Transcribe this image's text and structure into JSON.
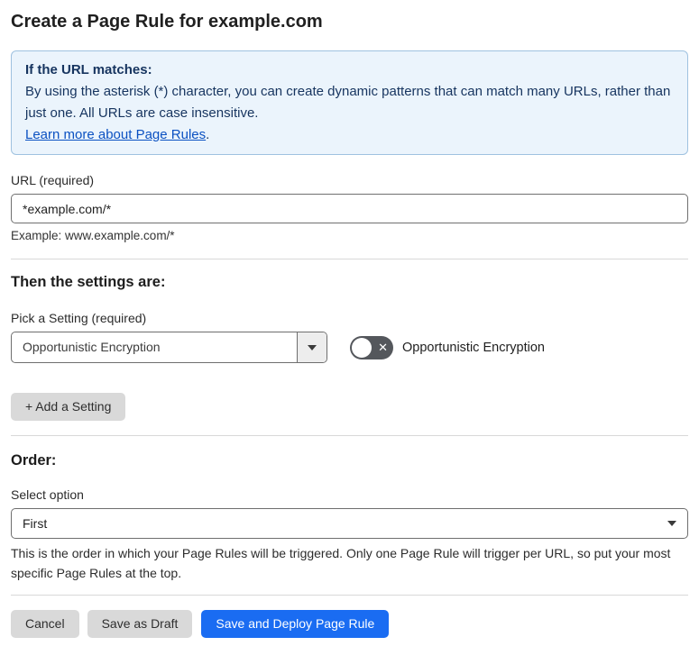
{
  "page": {
    "title": "Create a Page Rule for example.com"
  },
  "info_box": {
    "heading": "If the URL matches:",
    "body": "By using the asterisk (*) character, you can create dynamic patterns that can match many URLs, rather than just one. All URLs are case insensitive.",
    "link_label": "Learn more about Page Rules",
    "link_suffix": "."
  },
  "url_section": {
    "label": "URL (required)",
    "value": "*example.com/*",
    "example": "Example: www.example.com/*"
  },
  "settings_section": {
    "heading": "Then the settings are:",
    "label": "Pick a Setting (required)",
    "selected_setting": "Opportunistic Encryption",
    "toggle": {
      "state": "off",
      "label": "Opportunistic Encryption"
    },
    "add_button_label": "+ Add a Setting"
  },
  "order_section": {
    "heading": "Order:",
    "label": "Select option",
    "selected_option": "First",
    "help": "This is the order in which your Page Rules will be triggered. Only one Page Rule will trigger per URL, so put your most specific Page Rules at the top."
  },
  "footer": {
    "cancel_label": "Cancel",
    "save_draft_label": "Save as Draft",
    "deploy_label": "Save and Deploy Page Rule"
  },
  "icons": {
    "toggle_off_x": "✕",
    "caret_down": "caret-down"
  },
  "colors": {
    "accent_blue": "#1a6cf2",
    "info_bg": "#ebf4fc",
    "info_border": "#9fc2e0",
    "info_text": "#16345f",
    "link_blue": "#0b51c2",
    "toggle_off_bg": "#54575c",
    "button_gray": "#d9d9d9"
  }
}
